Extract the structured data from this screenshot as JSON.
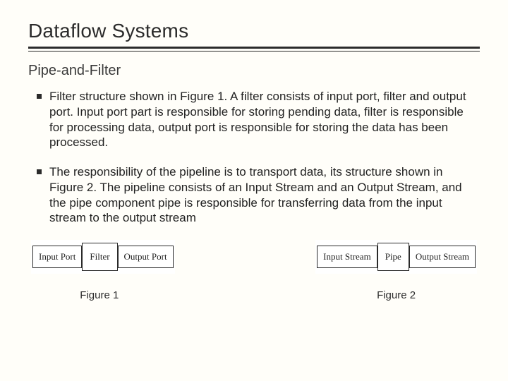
{
  "title": "Dataflow Systems",
  "subtitle": "Pipe-and-Filter",
  "bullets": [
    "Filter structure shown in Figure 1. A filter consists of input port, filter and output port. Input port part is responsible for storing pending data, filter is responsible for processing data, output port is responsible for storing the data has been processed.",
    "The responsibility of the pipeline is to transport data, its structure shown in Figure 2. The pipeline consists of an Input Stream and an Output Stream, and the pipe component pipe is responsible for transferring data from the input stream to the output stream"
  ],
  "figure1": {
    "boxes": [
      "Input Port",
      "Filter",
      "Output Port"
    ],
    "caption": "Figure  1"
  },
  "figure2": {
    "boxes": [
      "Input Stream",
      "Pipe",
      "Output Stream"
    ],
    "caption": "Figure  2"
  }
}
